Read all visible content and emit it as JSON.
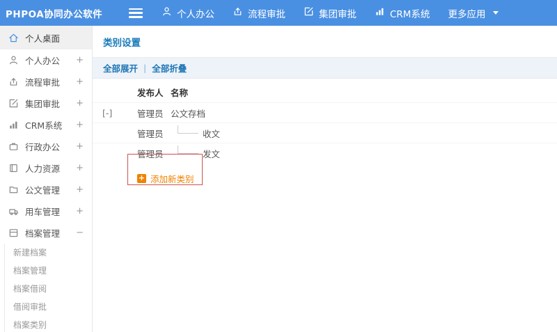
{
  "topbar": {
    "logo": "PHPOA协同办公软件",
    "nav": [
      {
        "label": "个人办公",
        "icon": "user-icon"
      },
      {
        "label": "流程审批",
        "icon": "send-icon"
      },
      {
        "label": "集团审批",
        "icon": "edit-icon"
      },
      {
        "label": "CRM系统",
        "icon": "chart-icon"
      },
      {
        "label": "更多应用",
        "icon": "caret-down-icon"
      }
    ]
  },
  "sidebar": {
    "items": [
      {
        "label": "个人桌面",
        "icon": "home-icon",
        "toggle": "",
        "active": true
      },
      {
        "label": "个人办公",
        "icon": "user-icon",
        "toggle": "+"
      },
      {
        "label": "流程审批",
        "icon": "send-icon",
        "toggle": "+"
      },
      {
        "label": "集团审批",
        "icon": "edit-icon",
        "toggle": "+"
      },
      {
        "label": "CRM系统",
        "icon": "chart-icon",
        "toggle": "+"
      },
      {
        "label": "行政办公",
        "icon": "briefcase-icon",
        "toggle": "+"
      },
      {
        "label": "人力资源",
        "icon": "book-icon",
        "toggle": "+"
      },
      {
        "label": "公文管理",
        "icon": "folder-icon",
        "toggle": "+"
      },
      {
        "label": "用车管理",
        "icon": "car-icon",
        "toggle": "+"
      },
      {
        "label": "档案管理",
        "icon": "archive-icon",
        "toggle": "−",
        "expanded": true
      }
    ],
    "submenu": [
      {
        "label": "新建档案"
      },
      {
        "label": "档案管理"
      },
      {
        "label": "档案借阅"
      },
      {
        "label": "借阅审批"
      },
      {
        "label": "档案类别"
      }
    ]
  },
  "main": {
    "title": "类别设置",
    "toolbar": {
      "expand_all": "全部展开",
      "separator": "|",
      "collapse_all": "全部折叠"
    },
    "table": {
      "headers": {
        "publisher": "发布人",
        "name": "名称"
      },
      "rows": [
        {
          "toggle": "[-]",
          "publisher": "管理员",
          "name": "公文存档",
          "level": 0
        },
        {
          "toggle": "",
          "publisher": "管理员",
          "name": "收文",
          "level": 1
        },
        {
          "toggle": "",
          "publisher": "管理员",
          "name": "发文",
          "level": 1
        }
      ]
    },
    "add_button_label": "添加新类别"
  },
  "colors": {
    "topbar_blue": "#4a90e2",
    "title_blue": "#1a7bb9",
    "link_blue": "#2077b5",
    "accent_orange": "#f08200",
    "annotation_red": "#c9534f"
  }
}
